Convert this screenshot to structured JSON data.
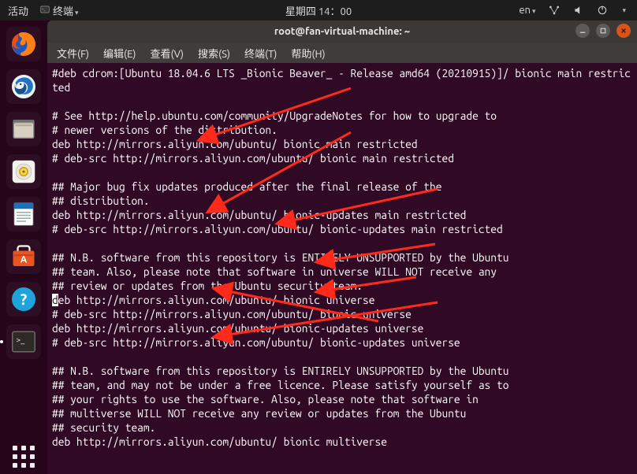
{
  "top_panel": {
    "activities": "活动",
    "app_menu": "终端",
    "clock": "星期四 14：00",
    "lang": "en"
  },
  "window": {
    "title": "root@fan-virtual-machine: ~"
  },
  "menubar": {
    "file": "文件(F)",
    "edit": "编辑(E)",
    "view": "查看(V)",
    "search": "搜索(S)",
    "terminal": "终端(T)",
    "help": "帮助(H)"
  },
  "terminal": {
    "l1": "#deb cdrom:[Ubuntu 18.04.6 LTS _Bionic Beaver_ - Release amd64 (20210915)]/ bionic main restricted",
    "l2": "",
    "l3": "# See http://help.ubuntu.com/community/UpgradeNotes for how to upgrade to",
    "l4": "# newer versions of the distribution.",
    "l5": "deb http://mirrors.aliyun.com/ubuntu/ bionic main restricted",
    "l6": "# deb-src http://mirrors.aliyun.com/ubuntu/ bionic main restricted",
    "l7": "",
    "l8": "## Major bug fix updates produced after the final release of the",
    "l9": "## distribution.",
    "l10": "deb http://mirrors.aliyun.com/ubuntu/ bionic-updates main restricted",
    "l11": "# deb-src http://mirrors.aliyun.com/ubuntu/ bionic-updates main restricted",
    "l12": "",
    "l13": "## N.B. software from this repository is ENTIRELY UNSUPPORTED by the Ubuntu",
    "l14": "## team. Also, please note that software in universe WILL NOT receive any",
    "l15": "## review or updates from the Ubuntu security team.",
    "l16a": "d",
    "l16b": "eb http://mirrors.aliyun.com/ubuntu/ bionic universe",
    "l17": "# deb-src http://mirrors.aliyun.com/ubuntu/ bionic universe",
    "l18": "deb http://mirrors.aliyun.com/ubuntu/ bionic-updates universe",
    "l19": "# deb-src http://mirrors.aliyun.com/ubuntu/ bionic-updates universe",
    "l20": "",
    "l21": "## N.B. software from this repository is ENTIRELY UNSUPPORTED by the Ubuntu",
    "l22": "## team, and may not be under a free licence. Please satisfy yourself as to",
    "l23": "## your rights to use the software. Also, please note that software in",
    "l24": "## multiverse WILL NOT receive any review or updates from the Ubuntu",
    "l25": "## security team.",
    "l26": "deb http://mirrors.aliyun.com/ubuntu/ bionic multiverse"
  }
}
